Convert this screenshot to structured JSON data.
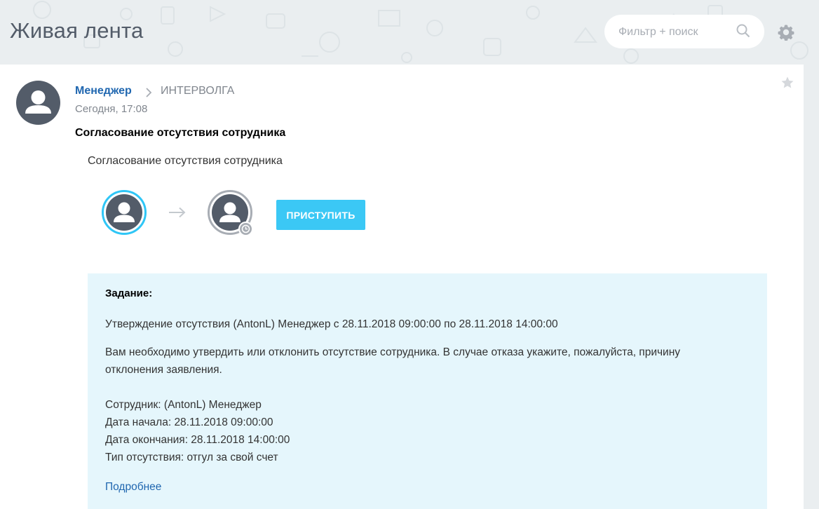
{
  "header": {
    "title": "Живая лента",
    "search": {
      "placeholder": "Фильтр + поиск",
      "value": ""
    }
  },
  "post": {
    "author": "Менеджер",
    "destination": "ИНТЕРВОЛГА",
    "date": "Сегодня, 17:08",
    "title": "Согласование отсутствия сотрудника",
    "process": {
      "title": "Согласование отсутствия сотрудника",
      "start_button": "ПРИСТУПИТЬ"
    },
    "task": {
      "label": "Задание:",
      "summary": "Утверждение отсутствия (AntonL) Менеджер с 28.11.2018 09:00:00 по 28.11.2018 14:00:00",
      "description": "Вам необходимо утвердить или отклонить отсутствие сотрудника. В случае отказа укажите, пожалуйста, причину отклонения заявления.",
      "employee": "Сотрудник: (AntonL) Менеджер",
      "start_date": "Дата начала: 28.11.2018 09:00:00",
      "end_date": "Дата окончания: 28.11.2018 14:00:00",
      "absence_type": "Тип отсутствия: отгул за свой счет",
      "more_link": "Подробнее"
    }
  },
  "icons": {
    "search": "search-icon",
    "settings": "gear-icon",
    "favorite": "star-icon",
    "arrow": "arrow-right-icon",
    "waiting": "clock-icon",
    "separator": "chevron-right-icon"
  },
  "colors": {
    "accent": "#3bc8f5",
    "link": "#2067b0",
    "task_background": "#e5f6fc",
    "avatar": "#535c69"
  }
}
